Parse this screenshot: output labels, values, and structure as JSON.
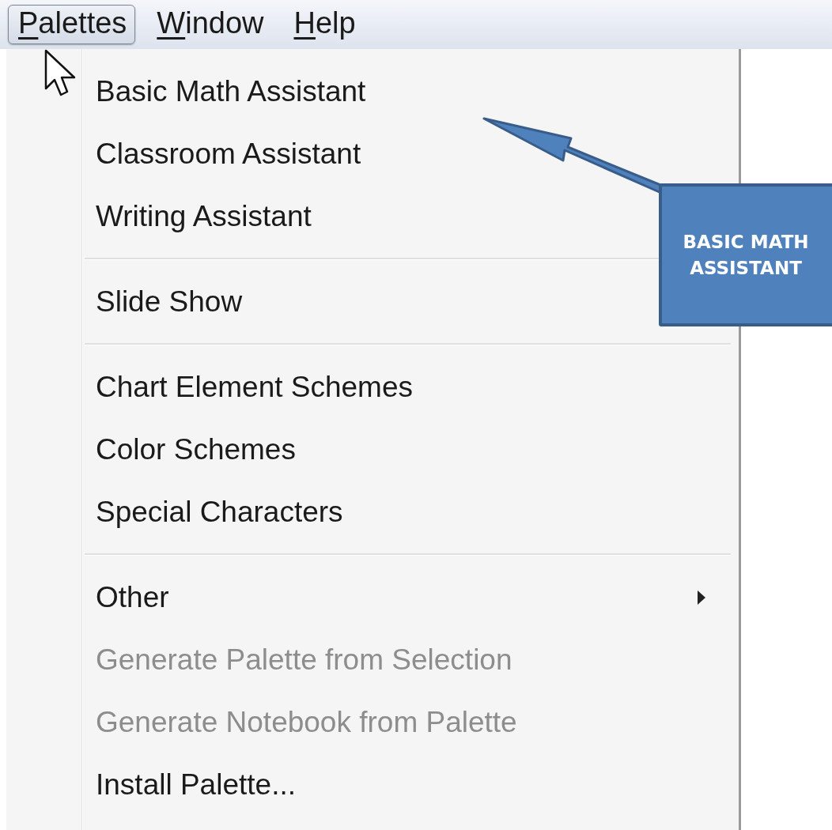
{
  "menu_bar": [
    {
      "mnemonic": "P",
      "rest": "alettes",
      "selected": true
    },
    {
      "mnemonic": "W",
      "rest": "indow",
      "selected": false
    },
    {
      "mnemonic": "H",
      "rest": "elp",
      "selected": false
    }
  ],
  "menu": [
    {
      "kind": "item",
      "label": "Basic Math Assistant",
      "disabled": false
    },
    {
      "kind": "item",
      "label": "Classroom Assistant",
      "disabled": false
    },
    {
      "kind": "item",
      "label": "Writing Assistant",
      "disabled": false
    },
    {
      "kind": "separator"
    },
    {
      "kind": "item",
      "label": "Slide Show",
      "disabled": false
    },
    {
      "kind": "separator"
    },
    {
      "kind": "item",
      "label": "Chart Element Schemes",
      "disabled": false
    },
    {
      "kind": "item",
      "label": "Color Schemes",
      "disabled": false
    },
    {
      "kind": "item",
      "label": "Special Characters",
      "disabled": false
    },
    {
      "kind": "separator"
    },
    {
      "kind": "submenu",
      "label": "Other",
      "disabled": false
    },
    {
      "kind": "item",
      "label": "Generate Palette from Selection",
      "disabled": true
    },
    {
      "kind": "item",
      "label": "Generate Notebook from Palette",
      "disabled": true
    },
    {
      "kind": "item",
      "label": "Install Palette...",
      "disabled": false
    }
  ],
  "callout": {
    "text": "BASIC MATH ASSISTANT"
  }
}
